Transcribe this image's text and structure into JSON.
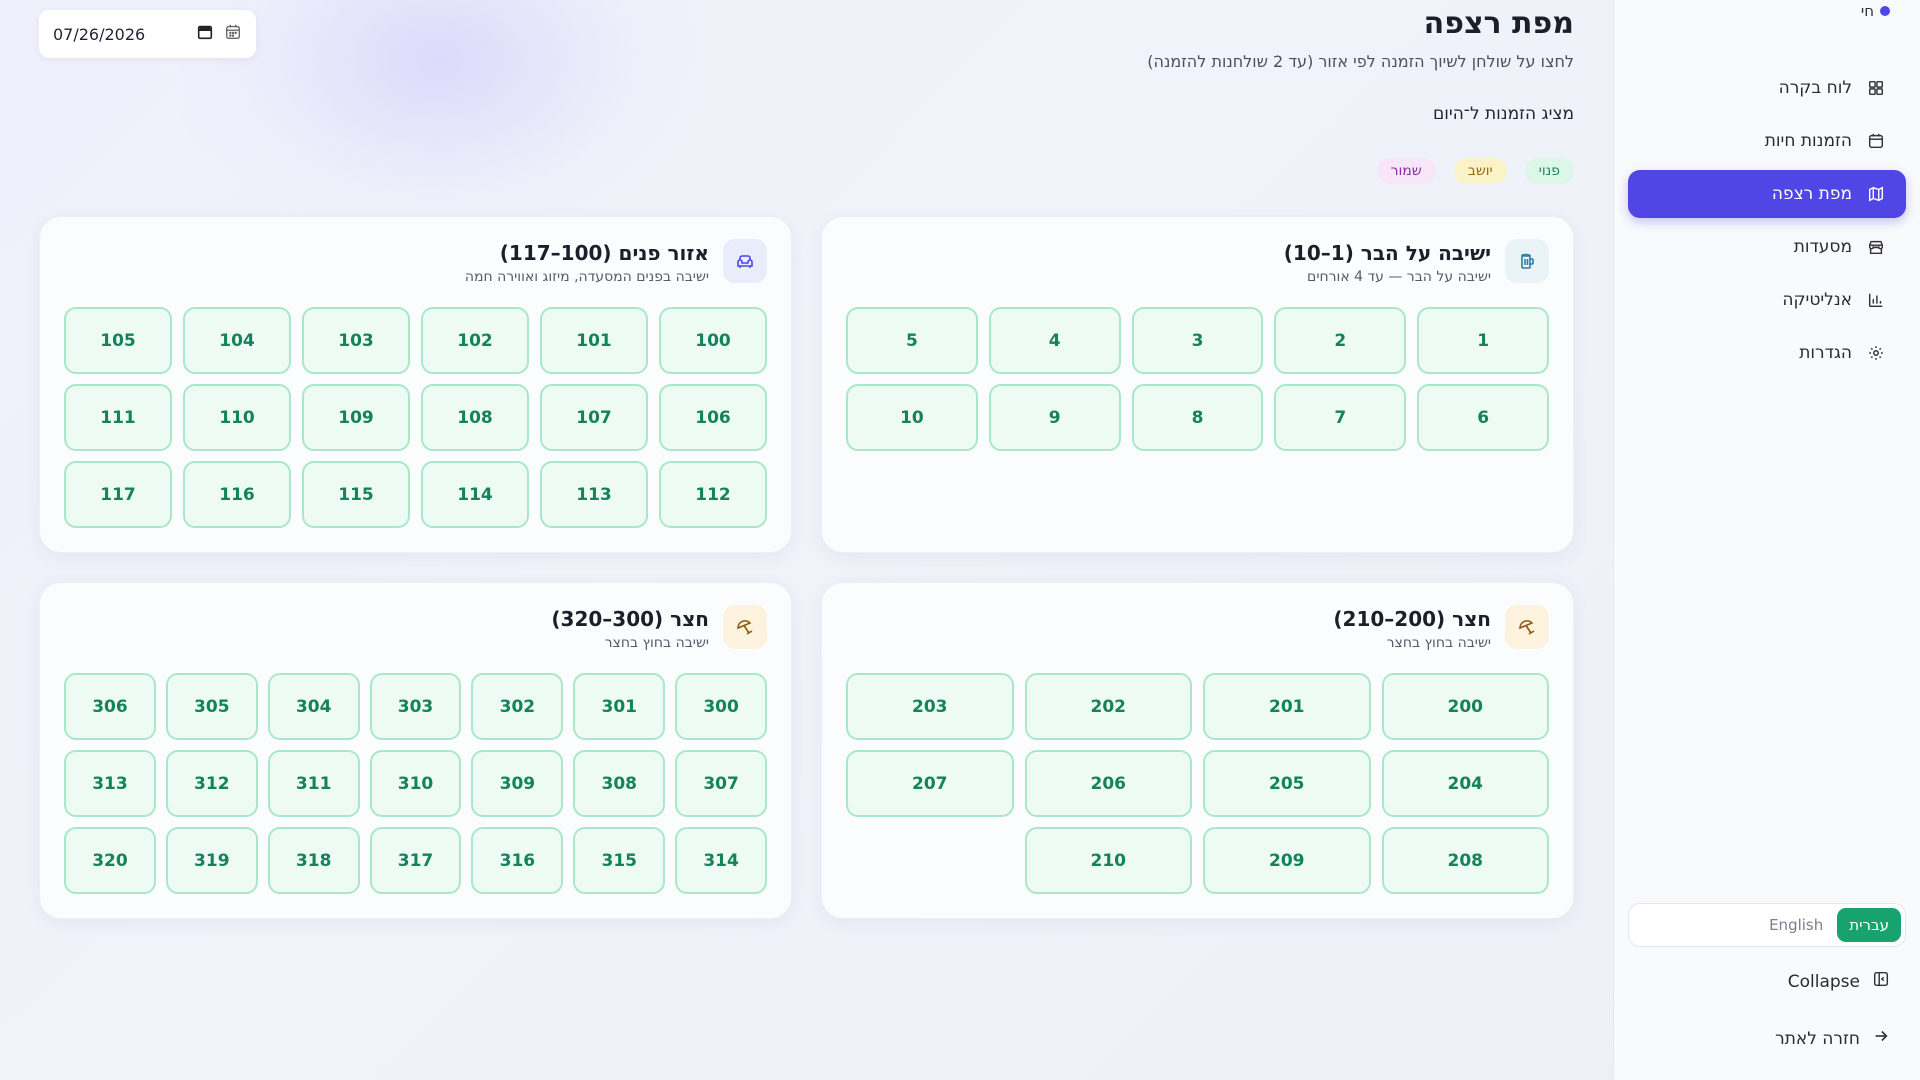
{
  "sidebar": {
    "brand": "חי",
    "items": [
      {
        "label": "לוח בקרה",
        "icon": "dashboard-icon",
        "active": false
      },
      {
        "label": "הזמנות חיות",
        "icon": "calendar-icon",
        "active": false
      },
      {
        "label": "מפת רצפה",
        "icon": "map-icon",
        "active": true
      },
      {
        "label": "מסעדות",
        "icon": "store-icon",
        "active": false
      },
      {
        "label": "אנליטיקה",
        "icon": "chart-icon",
        "active": false
      },
      {
        "label": "הגדרות",
        "icon": "gear-icon",
        "active": false
      }
    ],
    "lang_he": "עברית",
    "lang_en": "English",
    "collapse": "Collapse",
    "back": "חזרה לאתר"
  },
  "header": {
    "title": "מפת רצפה",
    "subtitle": "לחצו על שולחן לשיוך הזמנה לפי אזור (עד 2 שולחנות להזמנה)",
    "showing": "מציג הזמנות ל־היום",
    "date": "07/26/2026"
  },
  "legend": {
    "free": "פנוי",
    "seated": "יושב",
    "reserved": "שמור"
  },
  "colors": {
    "accent": "#4f46e5",
    "table_free": "#eefbf4",
    "table_border": "#a8e8c8",
    "table_text": "#14825a"
  },
  "zones": {
    "bar": {
      "title": "ישיבה על הבר (1–10)",
      "subtitle": "ישיבה על הבר — עד 4 אורחים",
      "icon": "beer-icon",
      "tables": [
        "1",
        "2",
        "3",
        "4",
        "5",
        "6",
        "7",
        "8",
        "9",
        "10"
      ]
    },
    "indoor": {
      "title": "אזור פנים (100–117)",
      "subtitle": "ישיבה בפנים המסעדה, מיזוג ואווירה חמה",
      "icon": "sofa-icon",
      "tables": [
        "100",
        "101",
        "102",
        "103",
        "104",
        "105",
        "106",
        "107",
        "108",
        "109",
        "110",
        "111",
        "112",
        "113",
        "114",
        "115",
        "116",
        "117"
      ]
    },
    "patio200": {
      "title": "חצר (200–210)",
      "subtitle": "ישיבה בחוץ בחצר",
      "icon": "umbrella-icon",
      "tables": [
        "200",
        "201",
        "202",
        "203",
        "204",
        "205",
        "206",
        "207",
        "208",
        "209",
        "210"
      ]
    },
    "patio300": {
      "title": "חצר (300–320)",
      "subtitle": "ישיבה בחוץ בחצר",
      "icon": "umbrella-icon",
      "tables": [
        "300",
        "301",
        "302",
        "303",
        "304",
        "305",
        "306",
        "307",
        "308",
        "309",
        "310",
        "311",
        "312",
        "313",
        "314",
        "315",
        "316",
        "317",
        "318",
        "319",
        "320"
      ]
    }
  }
}
